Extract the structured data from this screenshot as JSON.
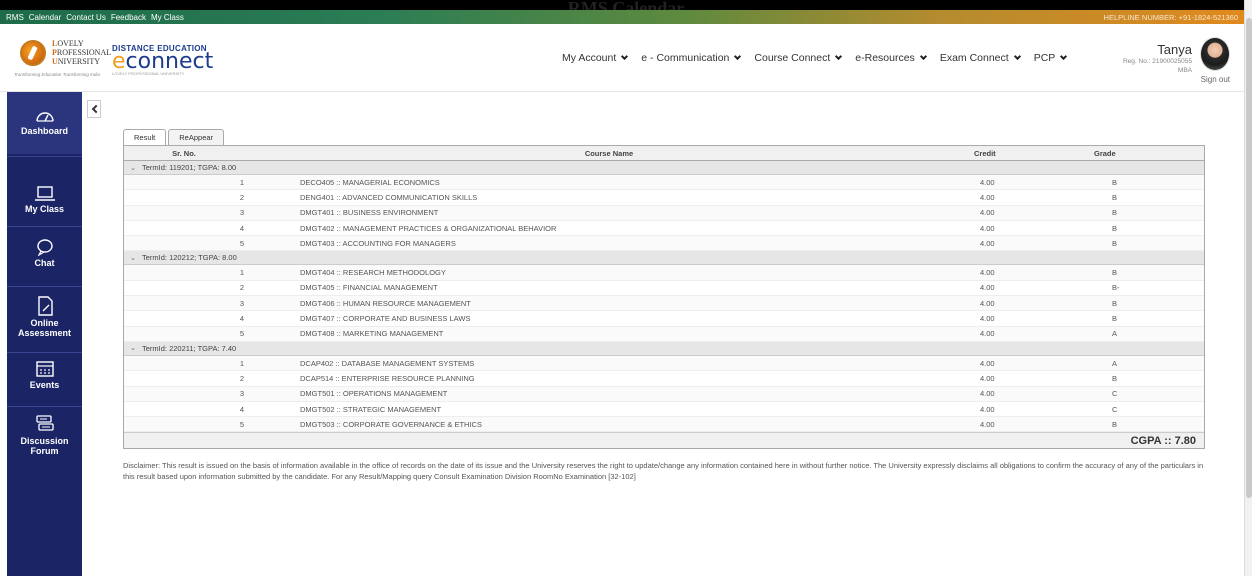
{
  "page_heading": "RMS Calendar",
  "util_bar": {
    "links": [
      "RMS",
      "Calendar",
      "Contact Us",
      "Feedback",
      "My Class"
    ],
    "helpline": "HELPLINE NUMBER: +91-1824-521360"
  },
  "branding": {
    "lpu_line1": "OVELY",
    "lpu_line2": "ROFESSIONAL",
    "lpu_line3": "NIVERSITY",
    "lpu_cap1": "L",
    "lpu_cap2": "P",
    "lpu_cap3": "U",
    "lpu_tagline": "Transforming Education Transforming India",
    "de_label": "DISTANCE EDUCATION",
    "econnect_e": "e",
    "econnect_word": "connect",
    "econnect_sub": "LOVELY PROFESSIONAL UNIVERSITY"
  },
  "nav": {
    "items": [
      "My Account",
      "e - Communication",
      "Course Connect",
      "e-Resources",
      "Exam Connect",
      "PCP"
    ]
  },
  "user": {
    "name": "Tanya",
    "reg": "Reg. No.: 21900025055",
    "program": "MBA",
    "sign_out": "Sign out"
  },
  "sidebar": {
    "items": [
      {
        "label_line1": "Dashboard",
        "label_line2": ""
      },
      {
        "label_line1": "My Class",
        "label_line2": ""
      },
      {
        "label_line1": "Chat",
        "label_line2": ""
      },
      {
        "label_line1": "Online",
        "label_line2": "Assessment"
      },
      {
        "label_line1": "Events",
        "label_line2": ""
      },
      {
        "label_line1": "Discussion",
        "label_line2": "Forum"
      }
    ]
  },
  "tabs": [
    "Result",
    "ReAppear"
  ],
  "table": {
    "headers": {
      "sr": "Sr. No.",
      "name": "Course Name",
      "credit": "Credit",
      "grade": "Grade"
    },
    "terms": [
      {
        "label": "TermId: 119201; TGPA: 8.00",
        "rows": [
          {
            "sr": "1",
            "name": "DECO405 :: MANAGERIAL ECONOMICS",
            "credit": "4.00",
            "grade": "B"
          },
          {
            "sr": "2",
            "name": "DENG401 :: ADVANCED COMMUNICATION SKILLS",
            "credit": "4.00",
            "grade": "B"
          },
          {
            "sr": "3",
            "name": "DMGT401 :: BUSINESS ENVIRONMENT",
            "credit": "4.00",
            "grade": "B"
          },
          {
            "sr": "4",
            "name": "DMGT402 :: MANAGEMENT PRACTICES & ORGANIZATIONAL BEHAVIOR",
            "credit": "4.00",
            "grade": "B"
          },
          {
            "sr": "5",
            "name": "DMGT403 :: ACCOUNTING FOR MANAGERS",
            "credit": "4.00",
            "grade": "B"
          }
        ]
      },
      {
        "label": "TermId: 120212; TGPA: 8.00",
        "rows": [
          {
            "sr": "1",
            "name": "DMGT404 :: RESEARCH METHODOLOGY",
            "credit": "4.00",
            "grade": "B"
          },
          {
            "sr": "2",
            "name": "DMGT405 :: FINANCIAL MANAGEMENT",
            "credit": "4.00",
            "grade": "B-"
          },
          {
            "sr": "3",
            "name": "DMGT406 :: HUMAN RESOURCE MANAGEMENT",
            "credit": "4.00",
            "grade": "B"
          },
          {
            "sr": "4",
            "name": "DMGT407 :: CORPORATE AND BUSINESS LAWS",
            "credit": "4.00",
            "grade": "B"
          },
          {
            "sr": "5",
            "name": "DMGT408 :: MARKETING MANAGEMENT",
            "credit": "4.00",
            "grade": "A"
          }
        ]
      },
      {
        "label": "TermId: 220211; TGPA: 7.40",
        "rows": [
          {
            "sr": "1",
            "name": "DCAP402 :: DATABASE MANAGEMENT SYSTEMS",
            "credit": "4.00",
            "grade": "A"
          },
          {
            "sr": "2",
            "name": "DCAP514 :: ENTERPRISE RESOURCE PLANNING",
            "credit": "4.00",
            "grade": "B"
          },
          {
            "sr": "3",
            "name": "DMGT501 :: OPERATIONS MANAGEMENT",
            "credit": "4.00",
            "grade": "C"
          },
          {
            "sr": "4",
            "name": "DMGT502 :: STRATEGIC MANAGEMENT",
            "credit": "4.00",
            "grade": "C"
          },
          {
            "sr": "5",
            "name": "DMGT503 :: CORPORATE GOVERNANCE & ETHICS",
            "credit": "4.00",
            "grade": "B"
          }
        ]
      }
    ],
    "cgpa": "CGPA :: 7.80"
  },
  "disclaimer": "Disclaimer: This result is issued on the basis of information available in the office of records on the date of its issue and the University reserves the right to update/change any information contained here in without further notice. The University expressly disclaims all obligations to confirm the accuracy of any of the particulars in this result based upon information submitted by the candidate. For any Result/Mapping query Consult Examination Division RoomNo Examination [32-102]",
  "colors": {
    "sidebar": "#1b2566",
    "brand_blue": "#1d3c8f",
    "brand_orange": "#e07b16"
  }
}
